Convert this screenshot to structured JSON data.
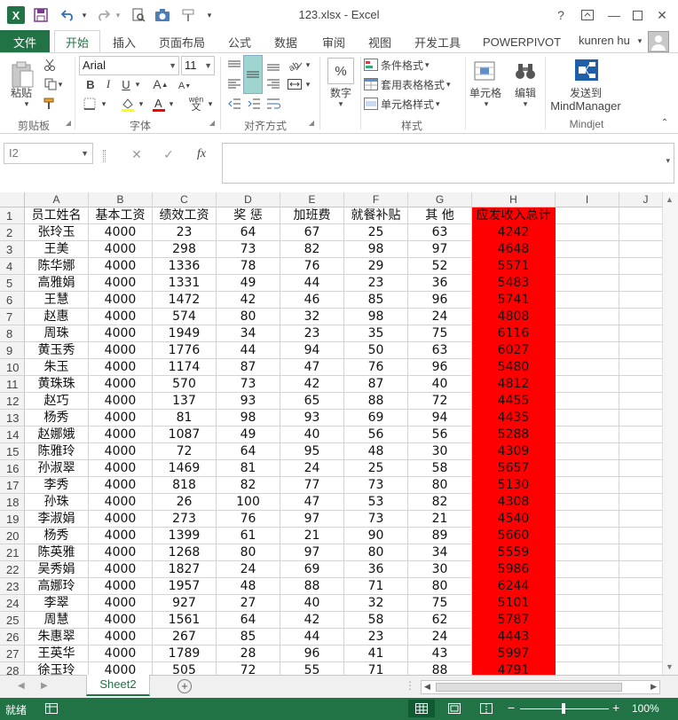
{
  "window": {
    "title": "123.xlsx - Excel",
    "logo": "X"
  },
  "quick_access": {
    "save_icon": "save-icon",
    "undo_icon": "undo-icon",
    "redo_icon": "redo-icon"
  },
  "tabs": {
    "file": "文件",
    "items": [
      "开始",
      "插入",
      "页面布局",
      "公式",
      "数据",
      "审阅",
      "视图",
      "开发工具",
      "POWERPIVOT"
    ],
    "active": "开始",
    "user": "kunren hu"
  },
  "ribbon": {
    "clipboard": {
      "paste": "粘贴",
      "label": "剪贴板"
    },
    "font": {
      "name": "Arial",
      "size": "11",
      "bold": "B",
      "italic": "I",
      "underline": "U",
      "grow": "A",
      "shrink": "A",
      "wen": "wén",
      "label": "字体"
    },
    "alignment": {
      "label": "对齐方式"
    },
    "number": {
      "percent": "%",
      "button": "数字"
    },
    "styles": {
      "conditional": "条件格式",
      "table": "套用表格格式",
      "cell": "单元格样式",
      "label": "样式"
    },
    "cells": {
      "button": "单元格"
    },
    "editing": {
      "button": "编辑"
    },
    "mindjet": {
      "line1": "发送到",
      "line2": "MindManager",
      "label": "Mindjet"
    }
  },
  "formula_bar": {
    "name_box": "I2",
    "cancel": "✕",
    "enter": "✓",
    "fx": "fx",
    "value": ""
  },
  "columns": [
    "A",
    "B",
    "C",
    "D",
    "E",
    "F",
    "G",
    "H",
    "I",
    "J"
  ],
  "table": {
    "headers": [
      "员工姓名",
      "基本工资",
      "绩效工资",
      "奖 惩",
      "加班费",
      "就餐补贴",
      "其 他",
      "应发收入总计"
    ],
    "rows": [
      [
        "张玲玉",
        "4000",
        "23",
        "64",
        "67",
        "25",
        "63",
        "4242"
      ],
      [
        "王美",
        "4000",
        "298",
        "73",
        "82",
        "98",
        "97",
        "4648"
      ],
      [
        "陈华娜",
        "4000",
        "1336",
        "78",
        "76",
        "29",
        "52",
        "5571"
      ],
      [
        "高雅娟",
        "4000",
        "1331",
        "49",
        "44",
        "23",
        "36",
        "5483"
      ],
      [
        "王慧",
        "4000",
        "1472",
        "42",
        "46",
        "85",
        "96",
        "5741"
      ],
      [
        "赵惠",
        "4000",
        "574",
        "80",
        "32",
        "98",
        "24",
        "4808"
      ],
      [
        "周珠",
        "4000",
        "1949",
        "34",
        "23",
        "35",
        "75",
        "6116"
      ],
      [
        "黄玉秀",
        "4000",
        "1776",
        "44",
        "94",
        "50",
        "63",
        "6027"
      ],
      [
        "朱玉",
        "4000",
        "1174",
        "87",
        "47",
        "76",
        "96",
        "5480"
      ],
      [
        "黄珠珠",
        "4000",
        "570",
        "73",
        "42",
        "87",
        "40",
        "4812"
      ],
      [
        "赵巧",
        "4000",
        "137",
        "93",
        "65",
        "88",
        "72",
        "4455"
      ],
      [
        "杨秀",
        "4000",
        "81",
        "98",
        "93",
        "69",
        "94",
        "4435"
      ],
      [
        "赵娜娥",
        "4000",
        "1087",
        "49",
        "40",
        "56",
        "56",
        "5288"
      ],
      [
        "陈雅玲",
        "4000",
        "72",
        "64",
        "95",
        "48",
        "30",
        "4309"
      ],
      [
        "孙淑翠",
        "4000",
        "1469",
        "81",
        "24",
        "25",
        "58",
        "5657"
      ],
      [
        "李秀",
        "4000",
        "818",
        "82",
        "77",
        "73",
        "80",
        "5130"
      ],
      [
        "孙珠",
        "4000",
        "26",
        "100",
        "47",
        "53",
        "82",
        "4308"
      ],
      [
        "李淑娟",
        "4000",
        "273",
        "76",
        "97",
        "73",
        "21",
        "4540"
      ],
      [
        "杨秀",
        "4000",
        "1399",
        "61",
        "21",
        "90",
        "89",
        "5660"
      ],
      [
        "陈英雅",
        "4000",
        "1268",
        "80",
        "97",
        "80",
        "34",
        "5559"
      ],
      [
        "吴秀娟",
        "4000",
        "1827",
        "24",
        "69",
        "36",
        "30",
        "5986"
      ],
      [
        "高娜玲",
        "4000",
        "1957",
        "48",
        "88",
        "71",
        "80",
        "6244"
      ],
      [
        "李翠",
        "4000",
        "927",
        "27",
        "40",
        "32",
        "75",
        "5101"
      ],
      [
        "周慧",
        "4000",
        "1561",
        "64",
        "42",
        "58",
        "62",
        "5787"
      ],
      [
        "朱惠翠",
        "4000",
        "267",
        "85",
        "44",
        "23",
        "24",
        "4443"
      ],
      [
        "王英华",
        "4000",
        "1789",
        "28",
        "96",
        "41",
        "43",
        "5997"
      ],
      [
        "徐玉玲",
        "4000",
        "505",
        "72",
        "55",
        "71",
        "88",
        "4791"
      ]
    ],
    "highlight_color": "#ff0000"
  },
  "sheet_tabs": {
    "active": "Sheet2"
  },
  "status_bar": {
    "text": "就绪",
    "zoom": "100%",
    "accent": "#217346"
  }
}
